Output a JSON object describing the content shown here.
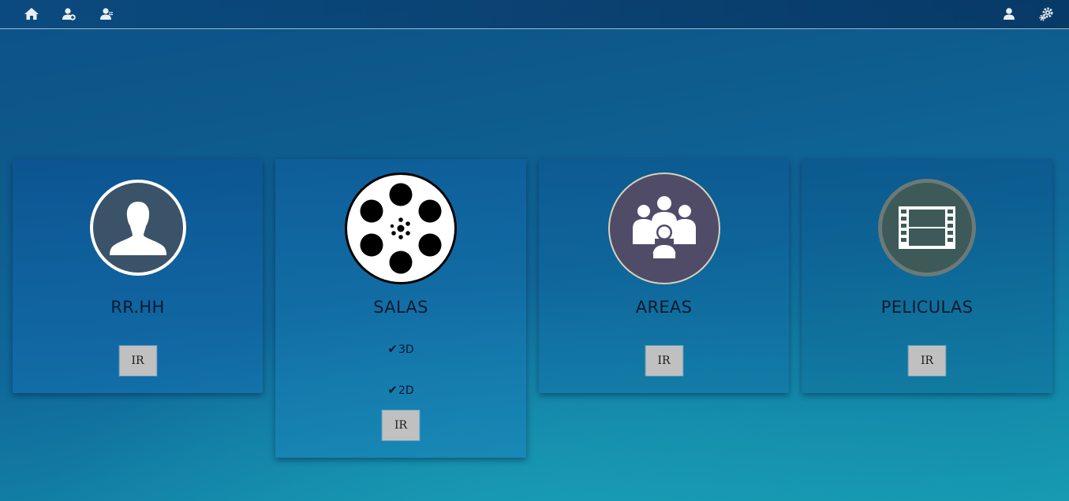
{
  "nav": {
    "left_icons": [
      "home-icon",
      "user-add-icon",
      "users-icon"
    ],
    "right_icons": [
      "user-icon",
      "settings-icon"
    ]
  },
  "cards": [
    {
      "title": "RR.HH",
      "icon": "person-silhouette-icon",
      "button_label": "IR"
    },
    {
      "title": "SALAS",
      "icon": "film-reel-icon",
      "options": [
        "3D",
        "2D"
      ],
      "check_glyph": "✔",
      "button_label": "IR"
    },
    {
      "title": "AREAS",
      "icon": "group-icon",
      "button_label": "IR"
    },
    {
      "title": "PELICULAS",
      "icon": "film-strip-icon",
      "button_label": "IR"
    }
  ],
  "colors": {
    "button_bg": "#c0c0c0",
    "title_text": "#0a1a2e",
    "rrhh_circle": "#3a5368",
    "areas_circle": "#504c68",
    "peliculas_circle": "#3d5a58"
  }
}
